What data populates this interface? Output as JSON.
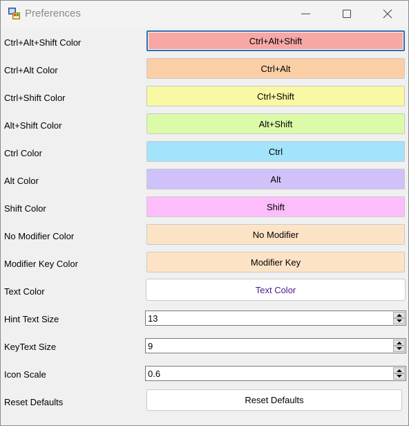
{
  "window": {
    "title": "Preferences",
    "icon": "preferences-app-icon",
    "controls": [
      "minimize-icon",
      "maximize-icon",
      "close-icon"
    ]
  },
  "color_settings": [
    {
      "label": "Ctrl+Alt+Shift Color",
      "button_text": "Ctrl+Alt+Shift",
      "color": "#f7a8a5",
      "text_color": "#000000"
    },
    {
      "label": "Ctrl+Alt Color",
      "button_text": "Ctrl+Alt",
      "color": "#fbcfa5",
      "text_color": "#000000"
    },
    {
      "label": "Ctrl+Shift Color",
      "button_text": "Ctrl+Shift",
      "color": "#f8f8a5",
      "text_color": "#000000"
    },
    {
      "label": "Alt+Shift Color",
      "button_text": "Alt+Shift",
      "color": "#dcfba8",
      "text_color": "#000000"
    },
    {
      "label": "Ctrl Color",
      "button_text": "Ctrl",
      "color": "#a3e3fc",
      "text_color": "#000000"
    },
    {
      "label": "Alt Color",
      "button_text": "Alt",
      "color": "#d1c1f9",
      "text_color": "#000000"
    },
    {
      "label": "Shift Color",
      "button_text": "Shift",
      "color": "#fdbdfb",
      "text_color": "#000000"
    },
    {
      "label": "No Modifier Color",
      "button_text": "No Modifier",
      "color": "#fde3c6",
      "text_color": "#000000"
    },
    {
      "label": "Modifier Key Color",
      "button_text": "Modifier Key",
      "color": "#fde3c6",
      "text_color": "#000000"
    },
    {
      "label": "Text Color",
      "button_text": "Text Color",
      "color": "#ffffff",
      "text_color": "#4b1a86"
    }
  ],
  "numeric_settings": [
    {
      "label": "Hint Text Size",
      "value": "13"
    },
    {
      "label": "KeyText Size",
      "value": "9"
    },
    {
      "label": "Icon Scale",
      "value": "0.6"
    }
  ],
  "reset": {
    "label": "Reset Defaults",
    "button_text": "Reset Defaults"
  }
}
